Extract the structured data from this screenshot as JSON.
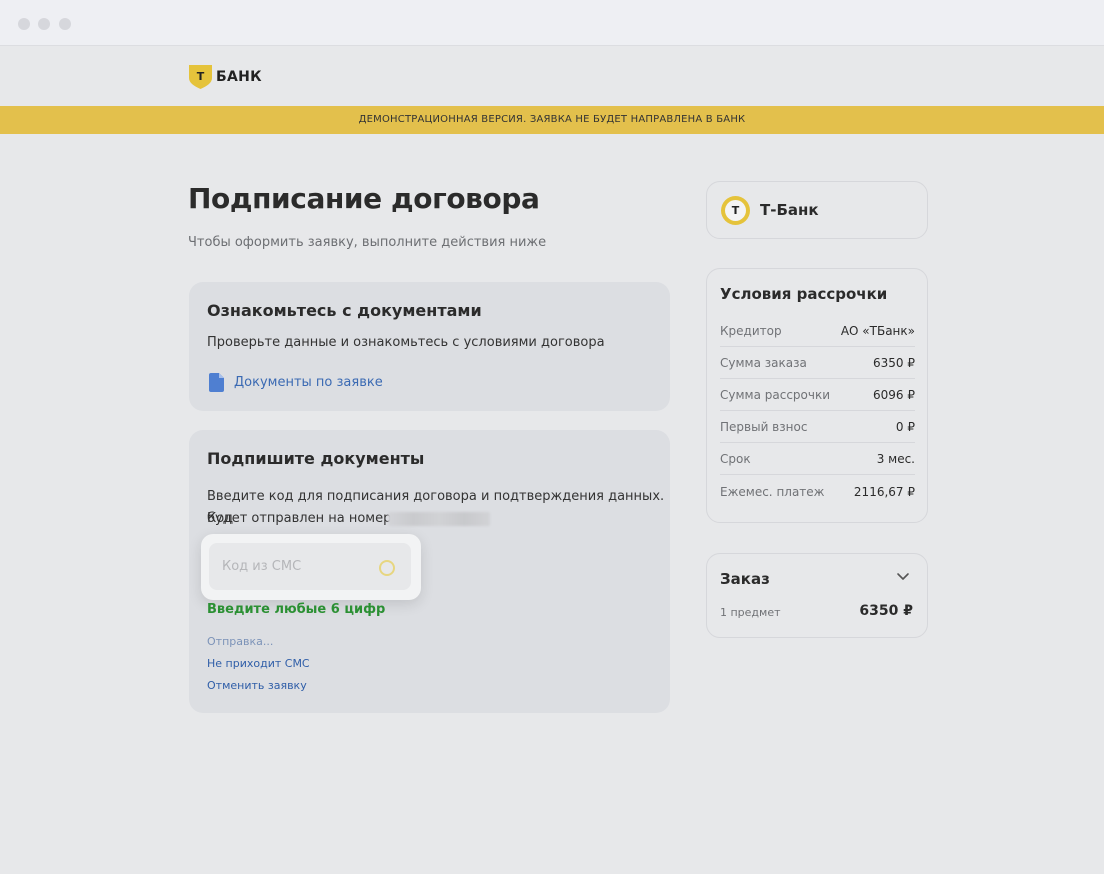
{
  "header": {
    "logo_text": "БАНК",
    "logo_letter": "Т"
  },
  "banner": {
    "text": "ДЕМОНСТРАЦИОННАЯ ВЕРСИЯ. ЗАЯВКА НЕ БУДЕТ НАПРАВЛЕНА В БАНК"
  },
  "page": {
    "title": "Подписание договора",
    "subtitle": "Чтобы оформить заявку, выполните действия ниже"
  },
  "documents_card": {
    "title": "Ознакомьтесь с документами",
    "text": "Проверьте данные и ознакомьтесь с условиями договора",
    "link_label": "Документы по заявке"
  },
  "sign_card": {
    "title": "Подпишите документы",
    "text_line1": "Введите код для подписания договора и подтверждения данных. Код",
    "text_line2": "будет отправлен на номер",
    "sms_placeholder": "Код из СМС",
    "hint": "Введите любые 6 цифр",
    "sending": "Отправка...",
    "no_sms": "Не приходит СМС",
    "cancel": "Отменить заявку"
  },
  "bank_card": {
    "logo_letter": "Т",
    "name": "Т-Банк"
  },
  "terms": {
    "title": "Условия рассрочки",
    "rows": [
      {
        "label": "Кредитор",
        "value": "АО «ТБанк»"
      },
      {
        "label": "Сумма заказа",
        "value": "6350 ₽"
      },
      {
        "label": "Сумма рассрочки",
        "value": "6096 ₽"
      },
      {
        "label": "Первый взнос",
        "value": "0 ₽"
      },
      {
        "label": "Срок",
        "value": "3 мес."
      },
      {
        "label": "Ежемес. платеж",
        "value": "2116,67 ₽"
      }
    ]
  },
  "order": {
    "title": "Заказ",
    "count": "1 предмет",
    "sum": "6350 ₽"
  },
  "colors": {
    "brand_yellow": "#e3c04c",
    "link_blue": "#3b6ab3",
    "hint_green": "#2b9033"
  }
}
